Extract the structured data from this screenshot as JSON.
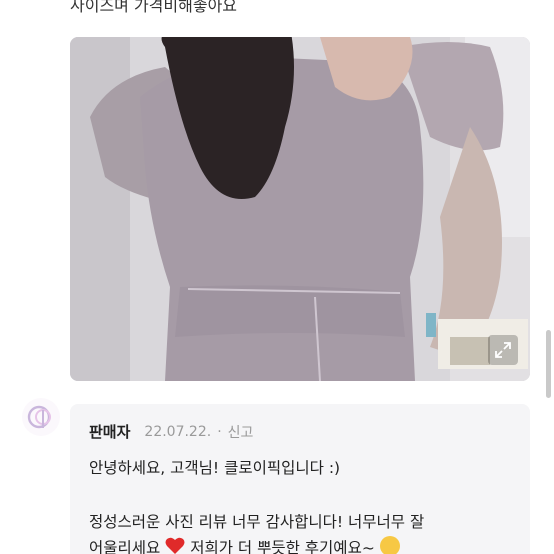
{
  "review": {
    "text": "사이즈며 가격비해좋아요"
  },
  "photo": {
    "alt": "review-photo"
  },
  "reply": {
    "seller_label": "판매자",
    "date": "22.07.22.",
    "separator": "·",
    "report_label": "신고",
    "line1": "안녕하세요, 고객님! 클로이픽입니다 :)",
    "line2": "정성스러운 사진 리뷰 너무 감사합니다! 너무너무 잘",
    "line3_a": "어울리세요",
    "line3_b": "저희가 더 뿌듯한 후기예요~"
  },
  "colors": {
    "heart": "#e02a2a",
    "reply_bg": "#f5f5f7",
    "muted_text": "#9a9a9a"
  },
  "icons": {
    "expand": "expand-icon",
    "heart": "heart-icon",
    "emoji": "teary-face-icon",
    "avatar": "seller-logo-icon"
  }
}
